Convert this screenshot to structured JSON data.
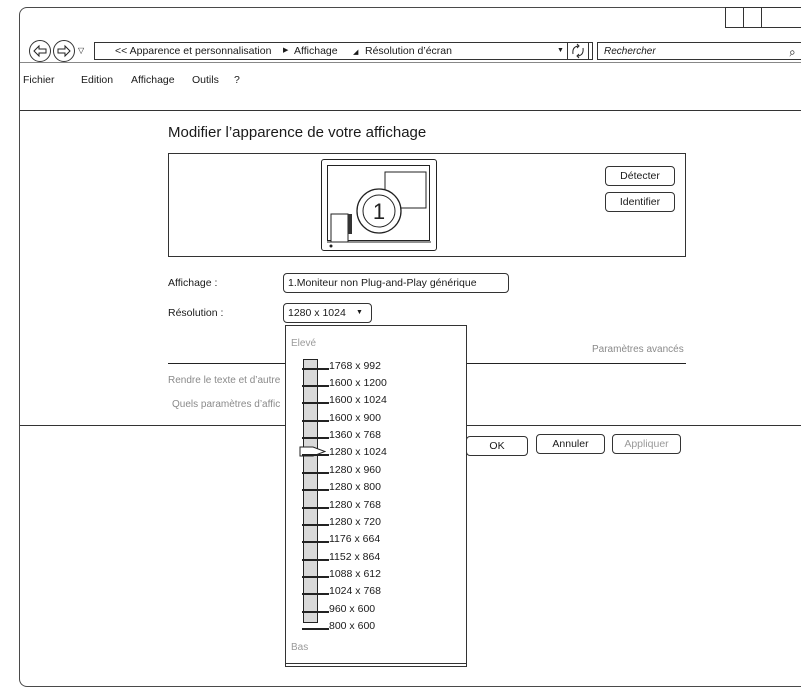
{
  "nav": {
    "breadcrumbs": [
      "<< Apparence et personnalisation",
      "Affichage",
      "Résolution d’écran"
    ],
    "search_placeholder": "Rechercher"
  },
  "menu": [
    "Fichier",
    "Edition",
    "Affichage",
    "Outils",
    "?"
  ],
  "main": {
    "title": "Modifier l’apparence de votre affichage",
    "monitor_number": "1",
    "detect_label": "Détecter",
    "identify_label": "Identifier",
    "display_label": "Affichage :",
    "display_value": "1.Moniteur non Plug-and-Play générique",
    "resolution_label": "Résolution :",
    "resolution_value": "1280 x 1024",
    "advanced_label": "Paramètres avancés",
    "link1": "Rendre le texte et d’autre",
    "link2": "Quels paramètres d’affic"
  },
  "footer": {
    "ok_label": "OK",
    "cancel_label": "Annuler",
    "apply_label": "Appliquer"
  },
  "resolution_popup": {
    "high_label": "Elevé",
    "low_label": "Bas",
    "options": [
      "1768 x 992",
      "1600 x 1200",
      "1600 x 1024",
      "1600 x 900",
      "1360 x 768",
      "1280 x 1024",
      "1280 x 960",
      "1280 x 800",
      "1280 x 768",
      "1280 x 720",
      "1176 x 664",
      "1152 x 864",
      "1088 x 612",
      "1024 x 768",
      "960 x 600",
      "800 x 600"
    ],
    "selected": "1280 x 1024"
  }
}
